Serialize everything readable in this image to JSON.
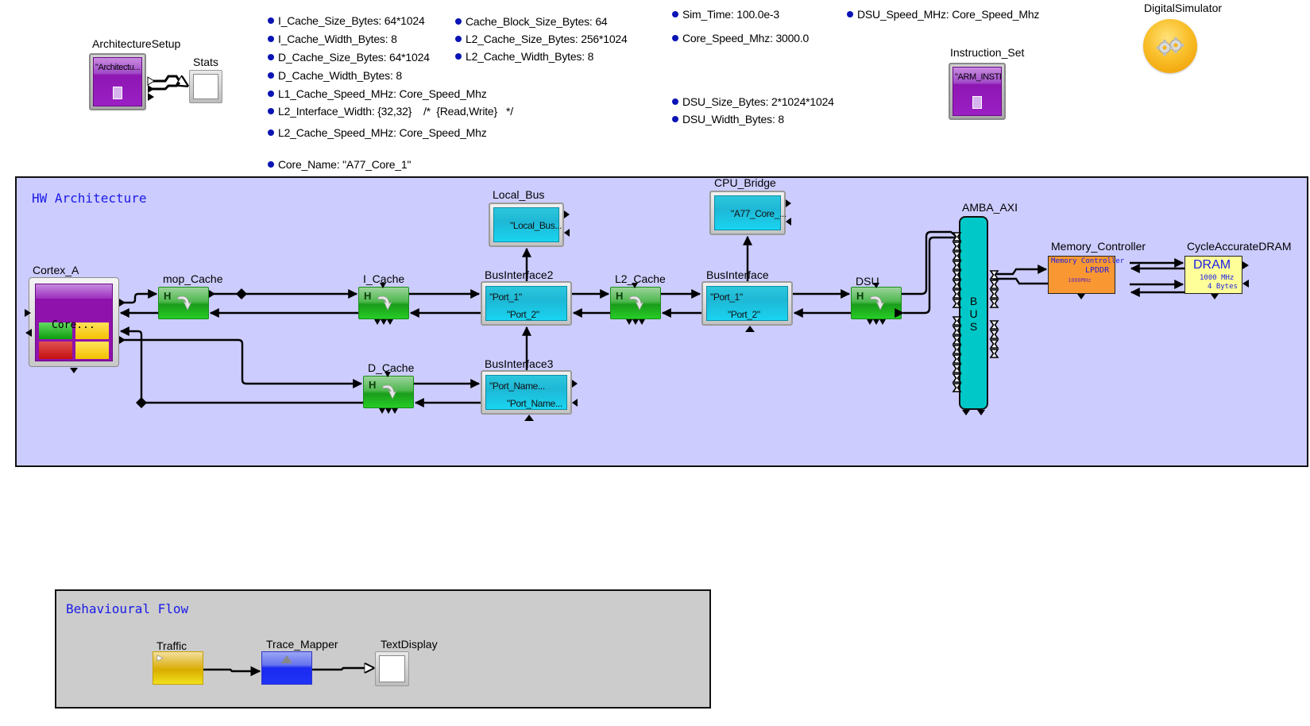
{
  "parameters": {
    "col1": [
      {
        "name": "I_Cache_Size_Bytes",
        "value": "64*1024"
      },
      {
        "name": "I_Cache_Width_Bytes",
        "value": "8"
      },
      {
        "name": "D_Cache_Size_Bytes",
        "value": "64*1024"
      },
      {
        "name": "D_Cache_Width_Bytes",
        "value": "8"
      },
      {
        "name": "L1_Cache_Speed_MHz",
        "value": "Core_Speed_Mhz"
      },
      {
        "name": "L2_Interface_Width",
        "value": "{32,32}    /*  {Read,Write}   */"
      },
      {
        "name": "L2_Cache_Speed_MHz",
        "value": "Core_Speed_Mhz"
      },
      {
        "name": "Core_Name",
        "value": "\"A77_Core_1\""
      }
    ],
    "col2": [
      {
        "name": "Cache_Block_Size_Bytes",
        "value": "64"
      },
      {
        "name": "L2_Cache_Size_Bytes",
        "value": "256*1024"
      },
      {
        "name": "L2_Cache_Width_Bytes",
        "value": "8"
      }
    ],
    "col3": [
      {
        "name": "Sim_Time",
        "value": "100.0e-3"
      },
      {
        "name": "Core_Speed_Mhz",
        "value": "3000.0"
      },
      {
        "name": "DSU_Size_Bytes",
        "value": "2*1024*1024"
      },
      {
        "name": "DSU_Width_Bytes",
        "value": "8"
      }
    ],
    "col4": [
      {
        "name": "DSU_Speed_MHz",
        "value": "Core_Speed_Mhz"
      }
    ]
  },
  "top_blocks": {
    "architecture_setup": {
      "label": "ArchitectureSetup",
      "text": "\"Architectu..."
    },
    "stats": {
      "label": "Stats"
    },
    "instruction_set": {
      "label": "Instruction_Set",
      "text": "\"ARM_INSTR\""
    },
    "digital_simulator": {
      "label": "DigitalSimulator",
      "icon": "gears-icon"
    }
  },
  "hw_architecture": {
    "title": "HW Architecture",
    "cortex_a": {
      "label": "Cortex_A",
      "text": "Core..."
    },
    "mop_cache": {
      "label": "mop_Cache",
      "glyph": "H"
    },
    "i_cache": {
      "label": "I_Cache",
      "glyph": "H"
    },
    "d_cache": {
      "label": "D_Cache",
      "glyph": "H"
    },
    "l2_cache": {
      "label": "L2_Cache",
      "glyph": "H"
    },
    "dsu": {
      "label": "DSU",
      "glyph": "H"
    },
    "local_bus": {
      "label": "Local_Bus",
      "text": "\"Local_Bus..."
    },
    "cpu_bridge": {
      "label": "CPU_Bridge",
      "text": "\"A77_Core_..."
    },
    "bus_interface2": {
      "label": "BusInterface2",
      "port1": "\"Port_1\"",
      "port2": "\"Port_2\""
    },
    "bus_interface3": {
      "label": "BusInterface3",
      "port1": "\"Port_Name...",
      "port2": "\"Port_Name..."
    },
    "bus_interface": {
      "label": "BusInterface",
      "port1": "\"Port_1\"",
      "port2": "\"Port_2\""
    },
    "amba_axi": {
      "label": "AMBA_AXI",
      "text": [
        "B",
        "U",
        "S"
      ]
    },
    "memory_controller": {
      "label": "Memory_Controller",
      "line1": "Memory Controller",
      "line2": "LPDDR",
      "line3": "1000MHz"
    },
    "dram": {
      "label": "CycleAccurateDRAM",
      "line1": "DRAM",
      "line2": "1000 MHz",
      "line3": "4 Bytes"
    }
  },
  "behavioural_flow": {
    "title": "Behavioural Flow",
    "traffic": {
      "label": "Traffic"
    },
    "trace_mapper": {
      "label": "Trace_Mapper"
    },
    "text_display": {
      "label": "TextDisplay"
    }
  },
  "colors": {
    "hw_background": "#ccccfe",
    "bf_background": "#cccccc",
    "param_bullet": "#0a14b4",
    "frame_title": "#1a1ae6"
  }
}
